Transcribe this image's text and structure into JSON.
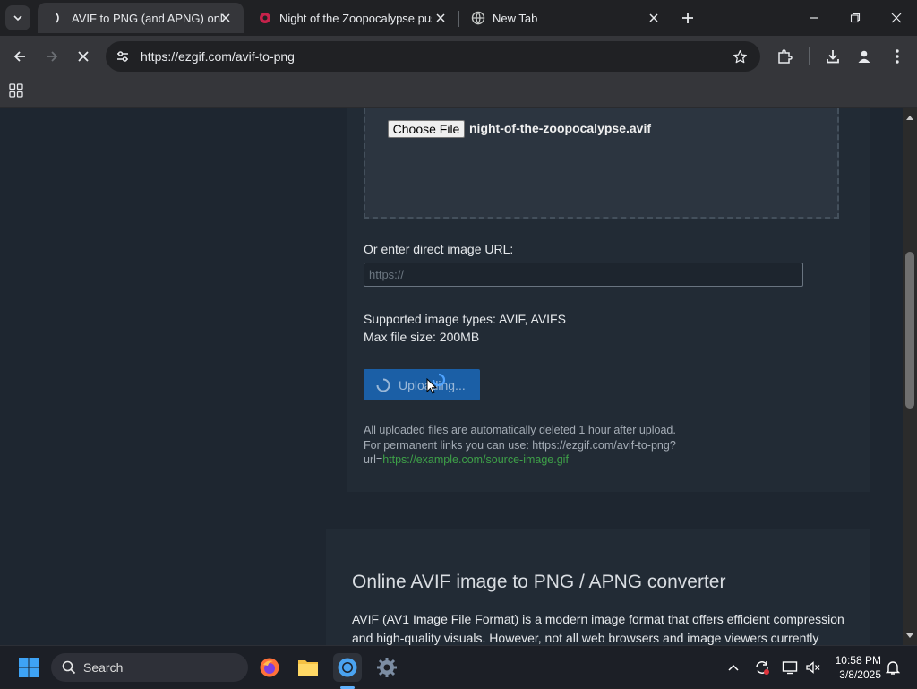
{
  "browser": {
    "tabs": [
      {
        "title": "AVIF to PNG (and APNG) online",
        "active": true
      },
      {
        "title": "Night of the Zoopocalypse pushe",
        "active": false
      },
      {
        "title": "New Tab",
        "active": false
      }
    ],
    "address": "https://ezgif.com/avif-to-png",
    "icons": {
      "back": "arrow-left-icon",
      "forward": "arrow-right-icon",
      "stop": "close-icon",
      "site_info": "tune-icon",
      "bookmark": "star-icon",
      "extensions": "puzzle-icon",
      "downloads": "download-icon",
      "profile": "person-icon",
      "menu": "kebab-menu-icon"
    }
  },
  "upload": {
    "choose_file_label": "Choose File",
    "file_name": "night-of-the-zoopocalypse.avif",
    "url_label": "Or enter direct image URL:",
    "url_placeholder": "https://",
    "url_value": "",
    "supported_types": "Supported image types: AVIF, AVIFS",
    "max_size": "Max file size: 200MB",
    "upload_button_label": "Uploading...",
    "info_line1": "All uploaded files are automatically deleted 1 hour after upload.",
    "info_line2": "For permanent links you can use: https://ezgif.com/avif-to-png?",
    "info_line3_prefix": "url=",
    "info_link": "https://example.com/source-image.gif"
  },
  "article": {
    "title": "Online AVIF image to PNG / APNG converter",
    "body": "AVIF (AV1 Image File Format) is a modern image format that offers efficient compression and high-quality visuals. However, not all web browsers and image viewers currently"
  },
  "taskbar": {
    "search_label": "Search",
    "time": "10:58 PM",
    "date": "3/8/2025"
  },
  "colors": {
    "upload_button": "#1b5fa6",
    "link_green": "#3ea048",
    "page_bg": "#1e2630"
  }
}
